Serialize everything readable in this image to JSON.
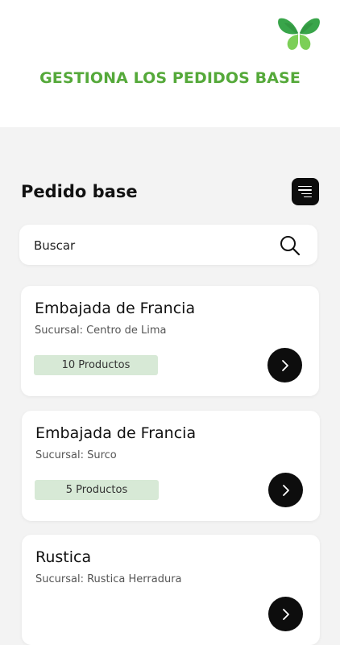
{
  "header": {
    "banner": "GESTIONA LOS PEDIDOS BASE",
    "logo_icon": "butterfly-logo-icon",
    "logo_colors": [
      "#2e9d3a",
      "#7ccf57"
    ]
  },
  "section": {
    "title": "Pedido base",
    "menu_icon": "menu-lines-icon"
  },
  "search": {
    "placeholder": "Buscar",
    "icon": "search-icon"
  },
  "orders": [
    {
      "name": "Embajada de Francia",
      "branch": "Sucursal: Centro de Lima",
      "products": "10 Productos"
    },
    {
      "name": "Embajada de Francia",
      "branch": "Sucursal: Surco",
      "products": "5 Productos"
    },
    {
      "name": "Rustica",
      "branch": "Sucursal: Rustica Herradura",
      "products": ""
    }
  ],
  "colors": {
    "accent": "#55a93a",
    "badge_bg": "#d7e9d6",
    "button": "#0d0d0d",
    "background": "#f3f3f3"
  }
}
